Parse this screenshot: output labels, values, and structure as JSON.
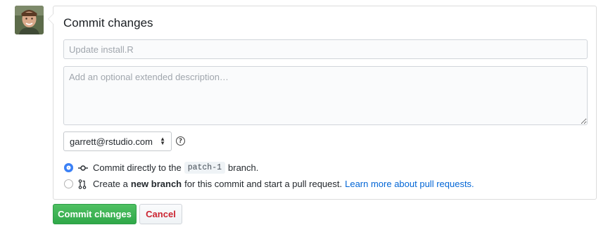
{
  "form": {
    "title": "Commit changes",
    "summary_placeholder": "Update install.R",
    "description_placeholder": "Add an optional extended description…",
    "author_email": "garrett@rstudio.com"
  },
  "options": {
    "direct": {
      "prefix": "Commit directly to the",
      "branch": "patch-1",
      "suffix": "branch.",
      "selected": true
    },
    "new_branch": {
      "prefix": "Create a",
      "bold": "new branch",
      "suffix": "for this commit and start a pull request.",
      "link": "Learn more about pull requests.",
      "selected": false
    }
  },
  "buttons": {
    "commit": "Commit changes",
    "cancel": "Cancel"
  },
  "icons": {
    "help": "question-circle-icon",
    "commit": "git-commit-icon",
    "pull_request": "git-pull-request-icon"
  },
  "colors": {
    "commit_button": "#2fa849",
    "cancel_text": "#cb2431",
    "link": "#0366d6",
    "radio_selected": "#3a80f6"
  }
}
